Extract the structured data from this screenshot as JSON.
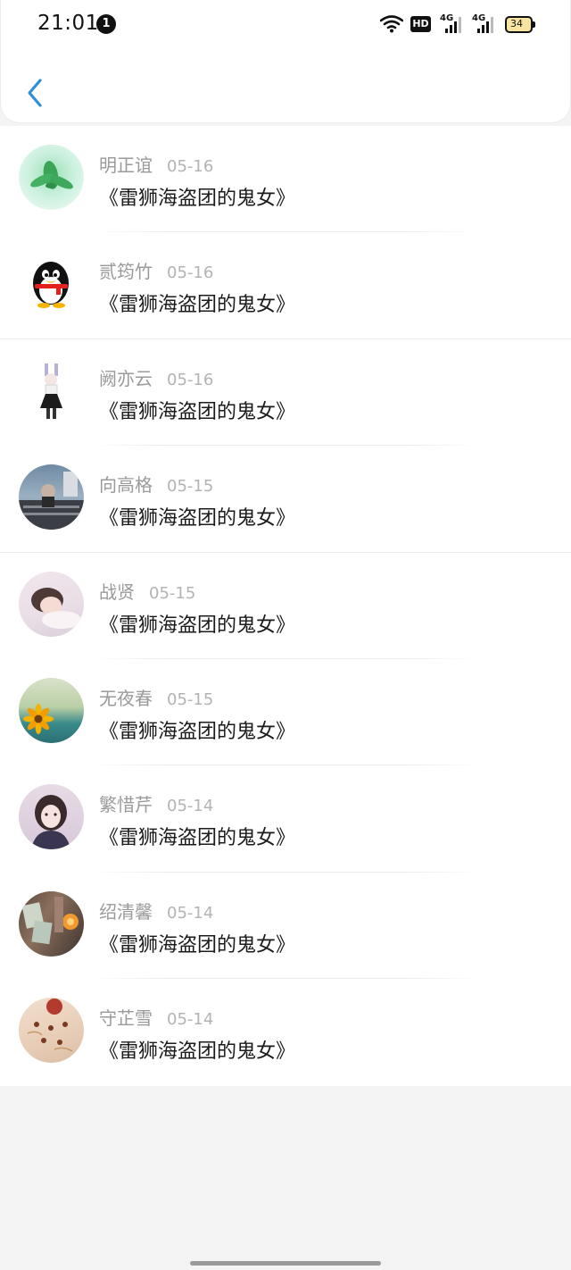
{
  "status_bar": {
    "time": "21:01",
    "notification_count": "1",
    "hd_label": "HD",
    "network_1": "4G",
    "network_2": "4G",
    "battery_level": "34"
  },
  "header": {
    "back_icon": "chevron-left-icon",
    "accent_color": "#2f8fd8"
  },
  "list": [
    {
      "name": "明正谊",
      "date": "05-16",
      "title": "《雷狮海盗团的鬼女》"
    },
    {
      "name": "贰筠竹",
      "date": "05-16",
      "title": "《雷狮海盗团的鬼女》"
    },
    {
      "name": "阙亦云",
      "date": "05-16",
      "title": "《雷狮海盗团的鬼女》"
    },
    {
      "name": "向高格",
      "date": "05-15",
      "title": "《雷狮海盗团的鬼女》"
    },
    {
      "name": "战贤",
      "date": "05-15",
      "title": "《雷狮海盗团的鬼女》"
    },
    {
      "name": "无夜春",
      "date": "05-15",
      "title": "《雷狮海盗团的鬼女》"
    },
    {
      "name": "繁惜芹",
      "date": "05-14",
      "title": "《雷狮海盗团的鬼女》"
    },
    {
      "name": "绍清馨",
      "date": "05-14",
      "title": "《雷狮海盗团的鬼女》"
    },
    {
      "name": "守芷雪",
      "date": "05-14",
      "title": "《雷狮海盗团的鬼女》"
    }
  ]
}
